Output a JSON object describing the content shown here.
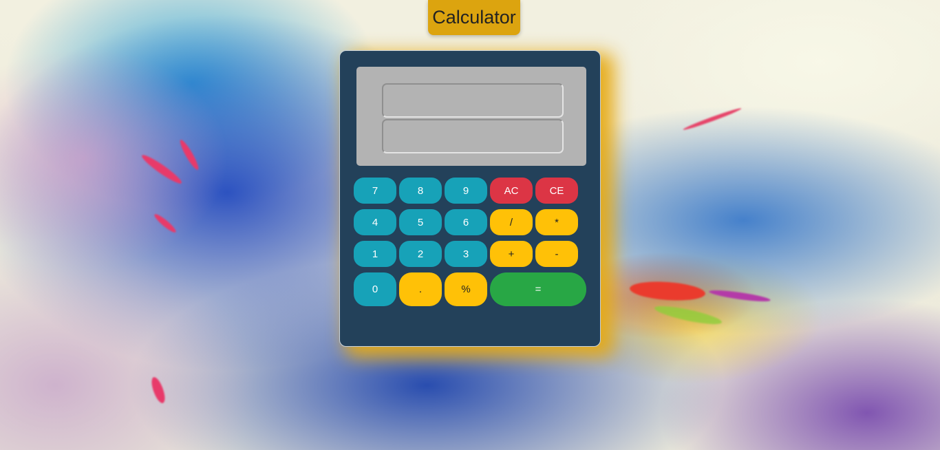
{
  "header": {
    "title": "Calculator"
  },
  "display": {
    "expression_value": "",
    "result_value": ""
  },
  "keypad": {
    "rows": [
      [
        {
          "label": "7"
        },
        {
          "label": "8"
        },
        {
          "label": "9"
        },
        {
          "label": "AC"
        },
        {
          "label": "CE"
        }
      ],
      [
        {
          "label": "4"
        },
        {
          "label": "5"
        },
        {
          "label": "6"
        },
        {
          "label": "/"
        },
        {
          "label": "*"
        }
      ],
      [
        {
          "label": "1"
        },
        {
          "label": "2"
        },
        {
          "label": "3"
        },
        {
          "label": "+"
        },
        {
          "label": "-"
        }
      ],
      [
        {
          "label": "0"
        },
        {
          "label": "."
        },
        {
          "label": "%"
        },
        {
          "label": "="
        }
      ]
    ]
  },
  "colors": {
    "title_badge": "#dca40f",
    "calculator_body": "#23415a",
    "screen": "#b3b3b3",
    "number_key": "#17a2b8",
    "clear_key": "#dc3545",
    "operator_key": "#ffc107",
    "equals_key": "#28a745",
    "glow": "#e6aa14"
  }
}
